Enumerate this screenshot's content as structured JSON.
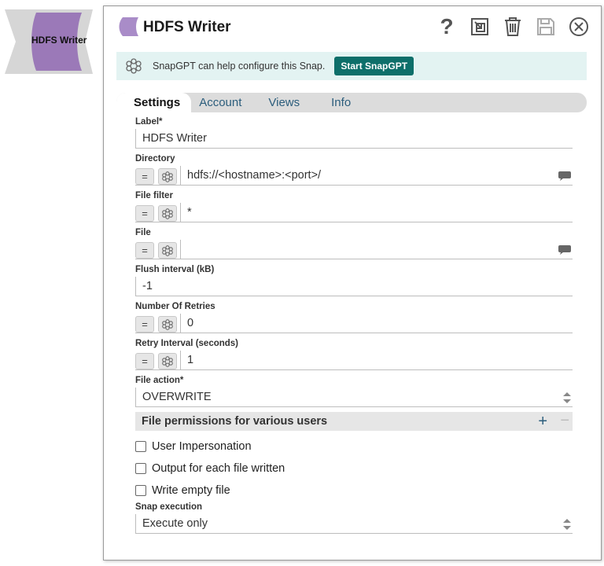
{
  "snap_icon": {
    "label": "HDFS Writer",
    "color": "#9b79b8"
  },
  "header": {
    "title": "HDFS Writer",
    "help_glyph": "?",
    "accent": "#a98cc8",
    "tools": [
      "help-icon",
      "export-icon",
      "delete-icon",
      "save-icon",
      "close-icon"
    ]
  },
  "snapgpt": {
    "text": "SnapGPT can help configure this Snap.",
    "button": "Start SnapGPT"
  },
  "tabs": [
    {
      "label": "Settings",
      "active": true
    },
    {
      "label": "Account",
      "active": false
    },
    {
      "label": "Views",
      "active": false
    },
    {
      "label": "Info",
      "active": false
    }
  ],
  "fields": {
    "label": {
      "label": "Label*",
      "value": "HDFS Writer"
    },
    "directory": {
      "label": "Directory",
      "value": "hdfs://<hostname>:<port>/"
    },
    "file_filter": {
      "label": "File filter",
      "value": "*"
    },
    "file": {
      "label": "File",
      "value": ""
    },
    "flush_interval": {
      "label": "Flush interval (kB)",
      "value": "-1"
    },
    "retries": {
      "label": "Number Of Retries",
      "value": "0"
    },
    "retry_interval": {
      "label": "Retry Interval (seconds)",
      "value": "1"
    },
    "file_action": {
      "label": "File action*",
      "value": "OVERWRITE"
    },
    "snap_execution": {
      "label": "Snap execution",
      "value": "Execute only"
    }
  },
  "expr_buttons": {
    "eq": "="
  },
  "permissions": {
    "title": "File permissions for various users",
    "plus": "+",
    "minus": "−"
  },
  "checkboxes": [
    {
      "label": "User Impersonation",
      "checked": false
    },
    {
      "label": "Output for each file written",
      "checked": false
    },
    {
      "label": "Write empty file",
      "checked": false
    }
  ]
}
